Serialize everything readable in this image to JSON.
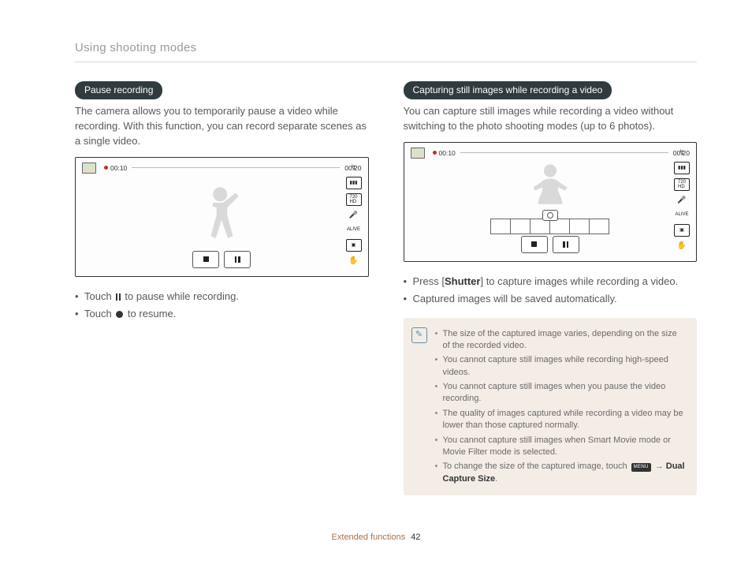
{
  "header": "Using shooting modes",
  "left": {
    "pill": "Pause recording",
    "para": "The camera allows you to temporarily pause a video while recording. With this function, you can record separate scenes as a single video.",
    "time_elapsed": "00:10",
    "time_total": "00:20",
    "b1_a": "Touch ",
    "b1_b": " to pause while recording.",
    "b2_a": "Touch ",
    "b2_b": " to resume."
  },
  "right": {
    "pill": "Capturing still images while recording a video",
    "para": "You can capture still images while recording a video without switching to the photo shooting modes (up to 6 photos).",
    "time_elapsed": "00:10",
    "time_total": "00:20",
    "b1_a": "Press [",
    "b1_bold": "Shutter",
    "b1_b": "] to capture images while recording a video.",
    "b2": "Captured images will be saved automatically."
  },
  "note": {
    "n1": "The size of the captured image varies, depending on the size of the recorded video.",
    "n2": "You cannot capture still images while recording high-speed videos.",
    "n3": "You cannot capture still images when you pause the video recording.",
    "n4": "The quality of images captured while recording a video may be lower than those captured normally.",
    "n5": "You cannot capture still images when Smart Movie mode or Movie Filter mode is selected.",
    "n6_a": "To change the size of the captured image, touch ",
    "n6_menu": "MENU",
    "n6_arrow": " → ",
    "n6_bold": "Dual Capture Size",
    "n6_end": "."
  },
  "footer_label": "Extended functions",
  "footer_page": "42"
}
